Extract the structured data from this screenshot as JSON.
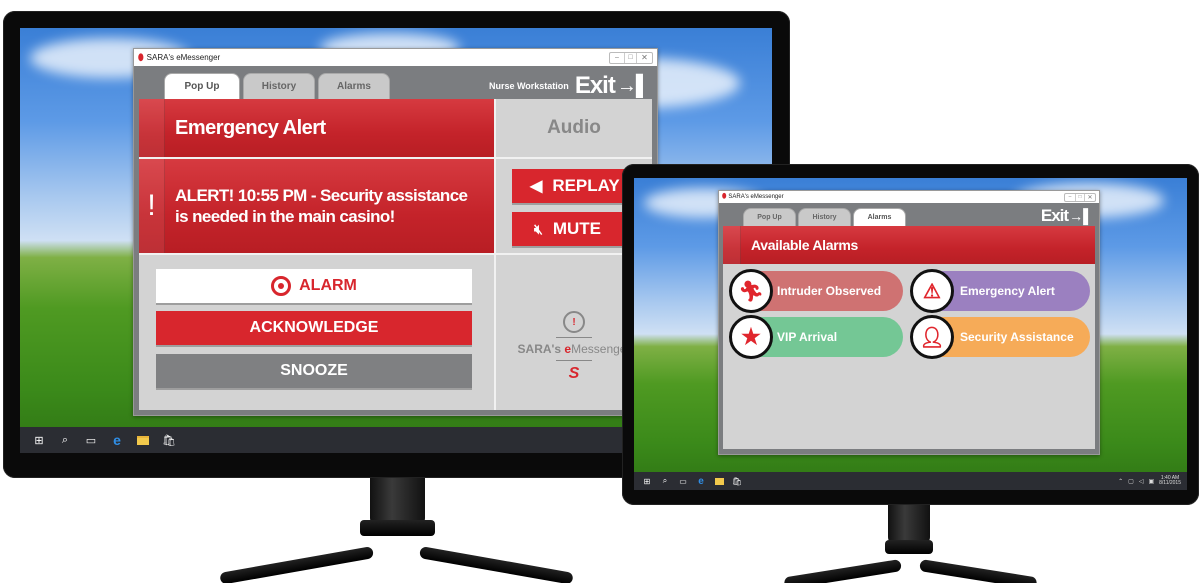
{
  "app": {
    "title": "SARA's eMessenger",
    "window_controls": [
      "minimize",
      "maximize",
      "close"
    ]
  },
  "left_screen": {
    "tabs": [
      {
        "label": "Pop Up",
        "active": true
      },
      {
        "label": "History",
        "active": false
      },
      {
        "label": "Alarms",
        "active": false
      }
    ],
    "workstation_label": "Nurse Workstation",
    "exit_label": "Exit",
    "alert_header": "Emergency Alert",
    "alert_icon": "!",
    "alert_message": "ALERT! 10:55 PM - Security assistance is needed in the main casino!",
    "audio_header": "Audio",
    "replay_label": "REPLAY",
    "mute_label": "MUTE",
    "alarm_label": "ALARM",
    "acknowledge_label": "ACKNOWLEDGE",
    "snooze_label": "SNOOZE",
    "brand": {
      "prefix": "SARA's ",
      "e": "e",
      "suffix": "Messenger"
    }
  },
  "right_screen": {
    "tabs": [
      {
        "label": "Pop Up",
        "active": false
      },
      {
        "label": "History",
        "active": false
      },
      {
        "label": "Alarms",
        "active": true
      }
    ],
    "exit_label": "Exit",
    "header": "Available Alarms",
    "alarms": [
      {
        "label": "Intruder Observed",
        "icon": "running-person-icon",
        "color": "#cf7272"
      },
      {
        "label": "Emergency Alert",
        "icon": "warning-triangle-icon",
        "color": "#9b80c0"
      },
      {
        "label": "VIP Arrival",
        "icon": "star-icon",
        "color": "#74c795"
      },
      {
        "label": "Security Assistance",
        "icon": "user-shield-icon",
        "color": "#f6ab58"
      }
    ],
    "clock": {
      "time": "1:40 AM",
      "date": "8/11/2015"
    }
  },
  "taskbar": {
    "icons": [
      "windows-start-icon",
      "search-icon",
      "task-view-icon",
      "edge-browser-icon",
      "file-explorer-icon",
      "store-icon"
    ]
  },
  "colors": {
    "brand_red": "#d8262d",
    "panel_grey": "#d3d3d3",
    "window_grey": "#7b7d80"
  }
}
